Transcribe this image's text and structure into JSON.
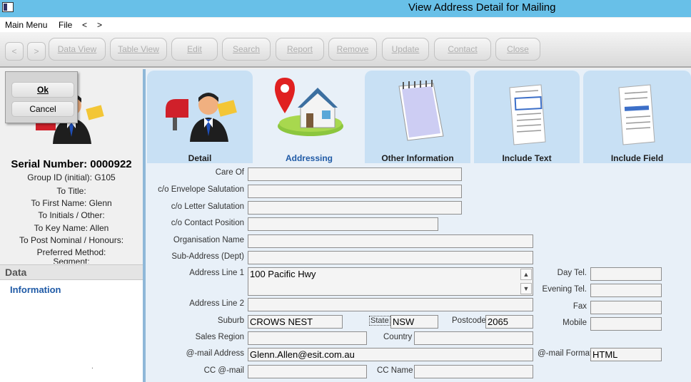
{
  "window": {
    "title": "View Address Detail for Mailing"
  },
  "menu": {
    "items": [
      "Main Menu",
      "File",
      "<",
      ">"
    ]
  },
  "toolbar": {
    "back": "<",
    "forward": ">",
    "buttons": [
      "Data View",
      "Table View",
      "Edit",
      "Search",
      "Report",
      "Remove",
      "Update",
      "Contact",
      "Close"
    ]
  },
  "dialog": {
    "ok": "Ok",
    "cancel": "Cancel"
  },
  "record": {
    "serial_number": "Serial Number: 0000922",
    "lines": [
      "Group ID (initial): G105",
      "To Title:",
      "To First Name: Glenn",
      "To Initials / Other:",
      "To Key Name: Allen",
      "To Post Nominal / Honours:",
      "Preferred Method:",
      "Segment:"
    ]
  },
  "side": {
    "header": "Data",
    "items": [
      "Information"
    ],
    "footer": "."
  },
  "tabs": [
    "Detail",
    "Addressing",
    "Other Information",
    "Include Text",
    "Include Field"
  ],
  "form": {
    "care_of": {
      "label": "Care Of",
      "value": ""
    },
    "envelope_salutation": {
      "label": "c/o  Envelope Salutation",
      "value": ""
    },
    "letter_salutation": {
      "label": "c/o Letter Salutation",
      "value": ""
    },
    "contact_position": {
      "label": "c/o Contact Position",
      "value": ""
    },
    "organisation_name": {
      "label": "Organisation Name",
      "value": ""
    },
    "sub_address": {
      "label": "Sub-Address (Dept)",
      "value": ""
    },
    "address_line_1": {
      "label": "Address Line 1",
      "value": "100 Pacific Hwy"
    },
    "address_line_2": {
      "label": "Address Line 2",
      "value": ""
    },
    "suburb": {
      "label": "Suburb",
      "value": "CROWS NEST"
    },
    "state": {
      "label": "State",
      "value": "NSW"
    },
    "postcode": {
      "label": "Postcode",
      "value": "2065"
    },
    "sales_region": {
      "label": "Sales Region",
      "value": ""
    },
    "country": {
      "label": "Country",
      "value": ""
    },
    "email_address": {
      "label": "@-mail Address",
      "value": "Glenn.Allen@esit.com.au"
    },
    "email_format": {
      "label": "@-mail Format",
      "value": "HTML"
    },
    "cc_email": {
      "label": "CC @-mail",
      "value": ""
    },
    "cc_name": {
      "label": "CC Name",
      "value": ""
    },
    "day_tel": {
      "label": "Day Tel.",
      "value": ""
    },
    "evening_tel": {
      "label": "Evening Tel.",
      "value": ""
    },
    "fax": {
      "label": "Fax",
      "value": ""
    },
    "mobile": {
      "label": "Mobile",
      "value": ""
    }
  },
  "colors": {
    "titlebar": "#68c0e8",
    "accent": "#1f5aa6"
  },
  "icons": [
    "app-icon",
    "contact-person-icon",
    "location-house-icon",
    "notepad-icon",
    "document-text-icon",
    "document-field-icon",
    "scroll-up-icon",
    "scroll-down-icon"
  ]
}
